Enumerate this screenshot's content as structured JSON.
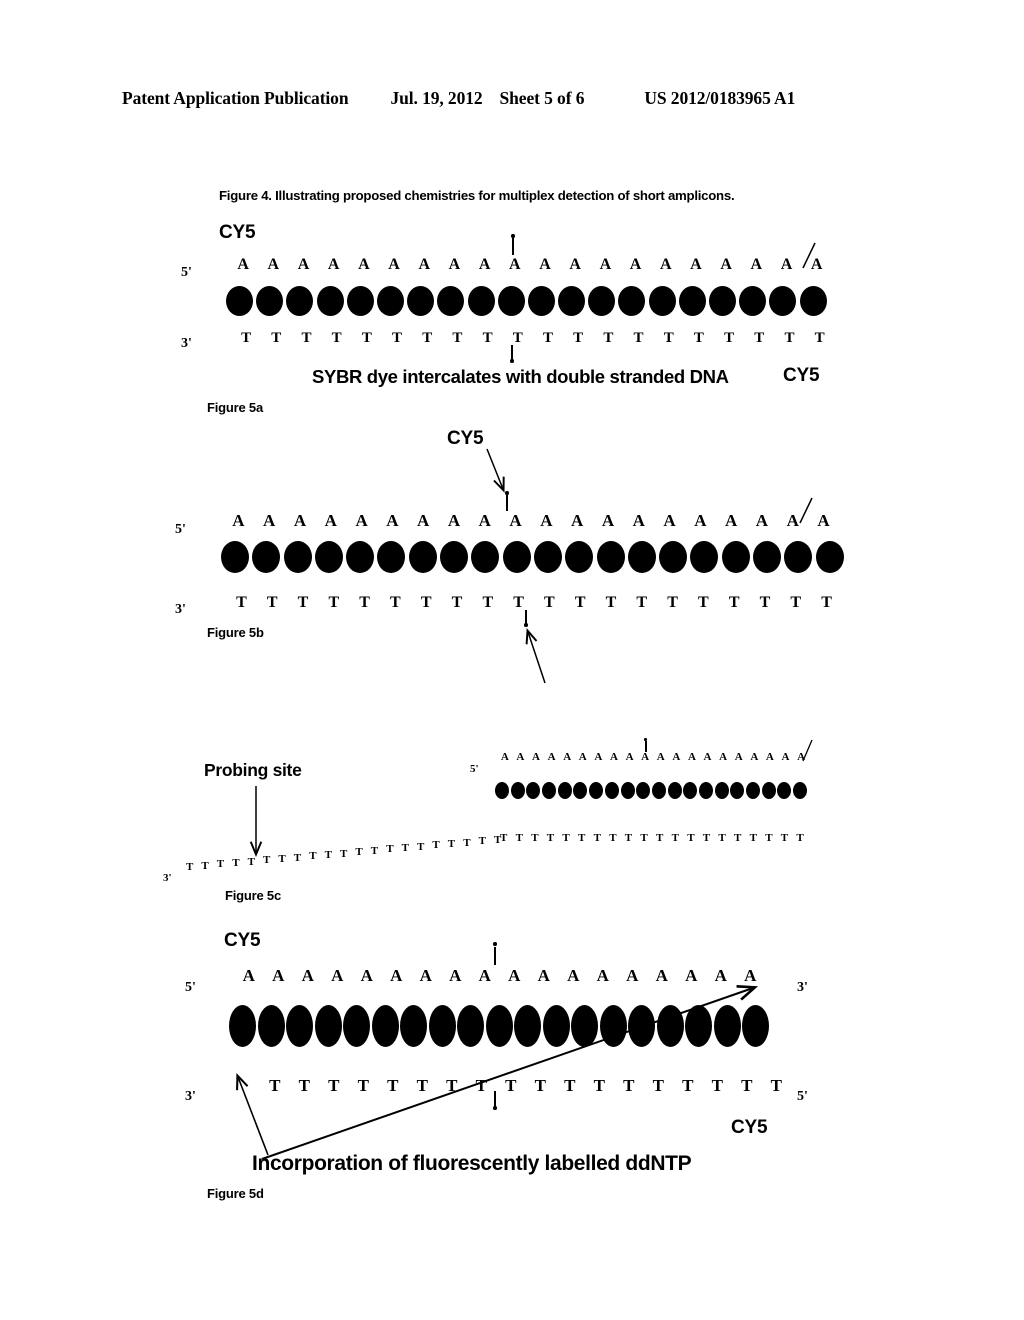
{
  "header": {
    "publication": "Patent Application Publication",
    "date": "Jul. 19, 2012",
    "sheet": "Sheet 5 of 6",
    "pub_number": "US 2012/0183965 A1"
  },
  "figure4": {
    "caption": "Figure 4. Illustrating proposed chemistries for multiplex detection of short amplicons."
  },
  "figures": {
    "fig5a": {
      "label": "Figure 5a",
      "cy5_top_left": "CY5",
      "cy5_caption_right": "CY5",
      "five_prime": "5'",
      "three_prime": "3'",
      "caption": "SYBR dye intercalates with double stranded DNA",
      "top_base": "A",
      "bottom_base": "T",
      "top_base_count": 20,
      "bottom_base_count": 20,
      "bead_count": 20
    },
    "fig5b": {
      "label": "Figure 5b",
      "cy5_pointer": "CY5",
      "five_prime": "5'",
      "three_prime": "3'",
      "top_base": "A",
      "bottom_base": "T",
      "top_base_count": 20,
      "bottom_base_count": 20,
      "bead_count": 20
    },
    "fig5c": {
      "label": "Figure 5c",
      "probing_site": "Probing site",
      "five_prime": "5'",
      "three_prime": "3'",
      "top_base": "A",
      "bottom_base": "T",
      "top_base_count": 20,
      "bead_count": 20,
      "slant_base_count": 21
    },
    "fig5d": {
      "label": "Figure 5d",
      "cy5_top_left": "CY5",
      "cy5_bottom_right": "CY5",
      "five_prime_left": "5'",
      "three_prime_left": "3'",
      "three_prime_right": "3'",
      "five_prime_right": "5'",
      "caption": "Incorporation of fluorescently labelled ddNTP",
      "top_base": "A",
      "bottom_base": "T",
      "top_base_count": 18,
      "bottom_base_count": 18,
      "bead_count": 19
    }
  },
  "colors": {
    "ink": "#000000",
    "paper": "#ffffff"
  }
}
